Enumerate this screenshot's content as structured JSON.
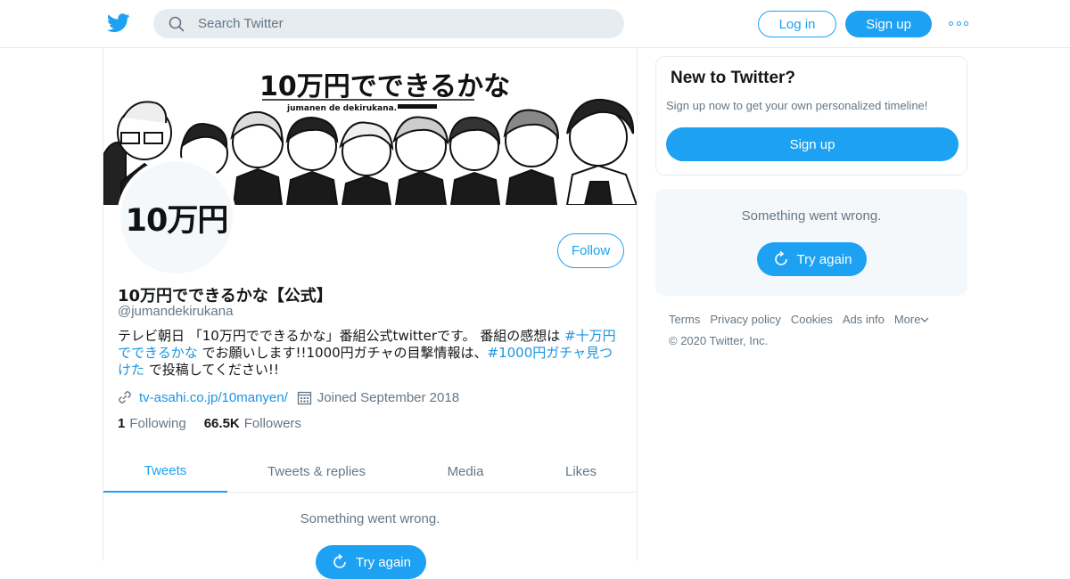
{
  "nav": {
    "search_placeholder": "Search Twitter",
    "login_label": "Log in",
    "signup_label": "Sign up"
  },
  "banner": {
    "title": "10万円でできるかな",
    "subtitle": "jumanen de dekirukana."
  },
  "avatar": {
    "text": "10万円"
  },
  "profile": {
    "follow_label": "Follow",
    "display_name": "10万円でできるかな【公式】",
    "handle": "@jumandekirukana",
    "bio_part1": "テレビ朝日 「10万円でできるかな」番組公式twitterです。 番組の感想は ",
    "bio_tag1": "#十万円でできるかな",
    "bio_part2": " でお願いします!!1000円ガチャの目撃情報は、",
    "bio_tag2": "#1000円ガチャ見つけた",
    "bio_part3": " で投稿してください!!",
    "website": "tv-asahi.co.jp/10manyen/",
    "joined": "Joined September 2018",
    "following_count": "1",
    "following_label": "Following",
    "followers_count": "66.5K",
    "followers_label": "Followers"
  },
  "tabs": [
    {
      "label": "Tweets",
      "active": true
    },
    {
      "label": "Tweets & replies",
      "active": false
    },
    {
      "label": "Media",
      "active": false
    },
    {
      "label": "Likes",
      "active": false
    }
  ],
  "timeline": {
    "error_text": "Something went wrong.",
    "retry_label": "Try again"
  },
  "sidebar": {
    "new_title": "New to Twitter?",
    "new_desc": "Sign up now to get your own personalized timeline!",
    "signup_label": "Sign up",
    "error_text": "Something went wrong.",
    "retry_label": "Try again",
    "footer_links": [
      "Terms",
      "Privacy policy",
      "Cookies",
      "Ads info",
      "More"
    ],
    "copyright": "© 2020 Twitter, Inc."
  },
  "colors": {
    "brand": "#1da1f2",
    "link": "#1b95e0",
    "muted": "#657786",
    "border": "#e6ecf0"
  },
  "icons": [
    "twitter-bird-icon",
    "search-icon",
    "more-dots-icon",
    "link-icon",
    "calendar-icon",
    "refresh-icon",
    "chevron-down-icon"
  ]
}
